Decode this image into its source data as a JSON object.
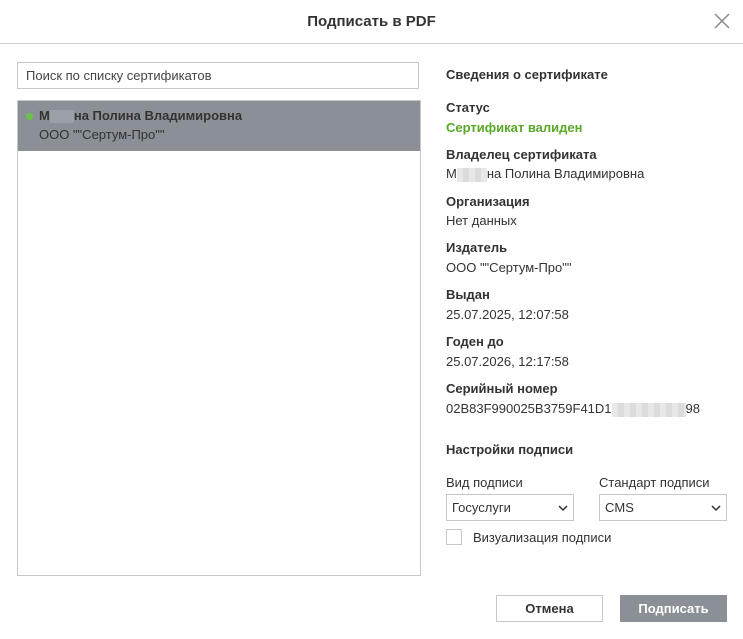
{
  "dialog": {
    "title": "Подписать в PDF"
  },
  "search": {
    "placeholder": "Поиск по списку сертификатов"
  },
  "certificates": [
    {
      "name_prefix": "М",
      "name_suffix": "на Полина Владимировна",
      "issuer": "ООО \"\"Сертум-Про\"\"",
      "status_color": "#6cc24a",
      "selected": true
    }
  ],
  "details": {
    "title": "Сведения о сертификате",
    "status_label": "Статус",
    "status_value": "Сертификат валиден",
    "status_color": "#5aa828",
    "owner_label": "Владелец сертификата",
    "owner_prefix": "М",
    "owner_suffix": "на Полина Владимировна",
    "org_label": "Организация",
    "org_value": "Нет данных",
    "issuer_label": "Издатель",
    "issuer_value": "ООО \"\"Сертум-Про\"\"",
    "issued_label": "Выдан",
    "issued_value": "25.07.2025, 12:07:58",
    "valid_label": "Годен до",
    "valid_value": "25.07.2026, 12:17:58",
    "serial_label": "Серийный номер",
    "serial_prefix": "02B83F990025B3759F41D1",
    "serial_suffix": "98"
  },
  "settings": {
    "title": "Настройки подписи",
    "type_label": "Вид подписи",
    "type_value": "Госуслуги",
    "standard_label": "Стандарт подписи",
    "standard_value": "CMS",
    "visualize_label": "Визуализация подписи",
    "visualize_checked": false
  },
  "buttons": {
    "cancel": "Отмена",
    "sign": "Подписать"
  },
  "colors": {
    "selected_row": "#8b9096",
    "primary_button": "#8b9096"
  }
}
